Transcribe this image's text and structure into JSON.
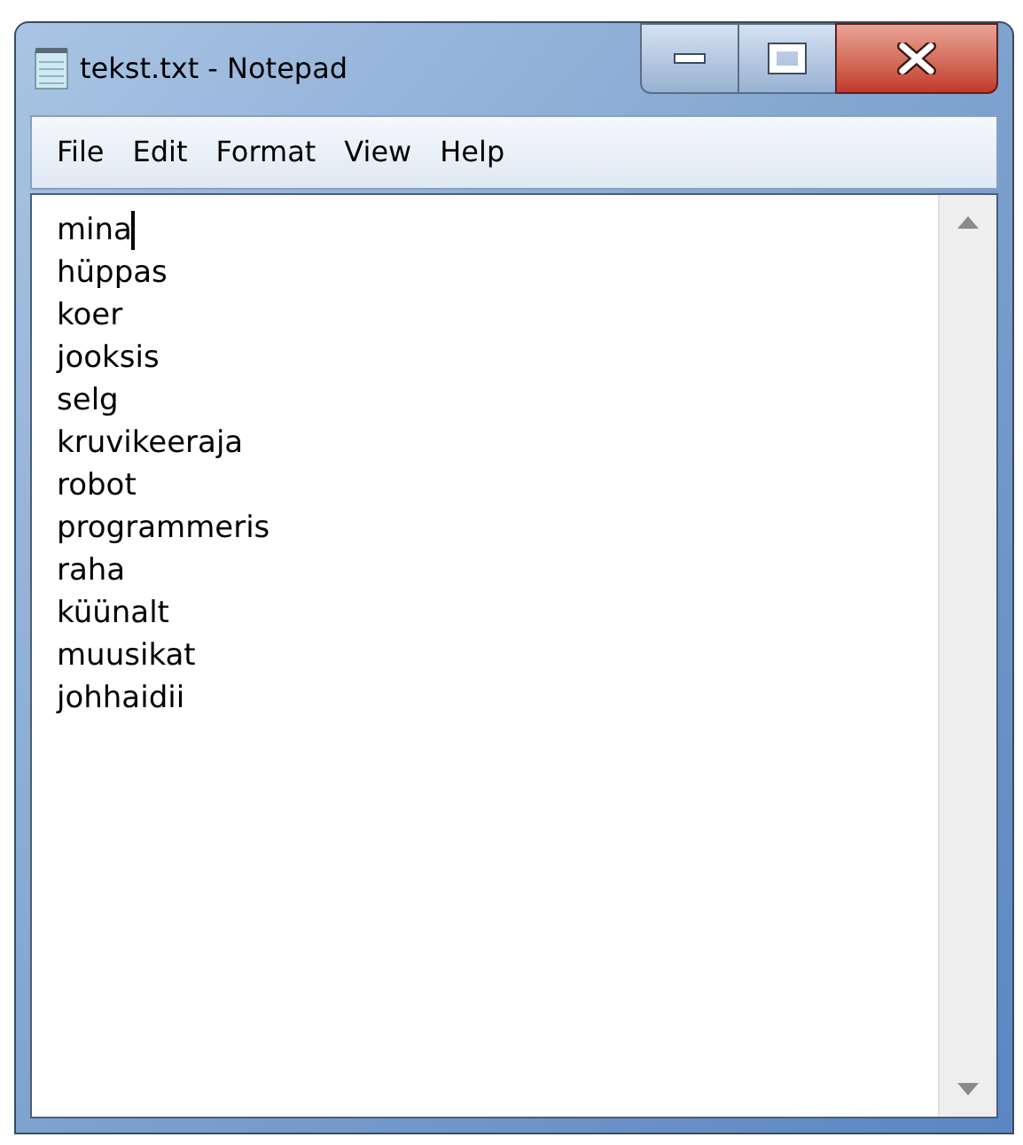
{
  "window": {
    "title": "tekst.txt - Notepad"
  },
  "menu": [
    "File",
    "Edit",
    "Format",
    "View",
    "Help"
  ],
  "editor": {
    "lines": [
      {
        "text": "mina",
        "cursor": true
      },
      {
        "text": "hüppas",
        "cursor": false
      },
      {
        "text": "koer",
        "cursor": false
      },
      {
        "text": "jooksis",
        "cursor": false
      },
      {
        "text": "selg",
        "cursor": false
      },
      {
        "text": "kruvikeeraja",
        "cursor": false
      },
      {
        "text": "robot",
        "cursor": false
      },
      {
        "text": "programmeris",
        "cursor": false
      },
      {
        "text": "raha",
        "cursor": false
      },
      {
        "text": "küünalt",
        "cursor": false
      },
      {
        "text": "muusikat",
        "cursor": false
      },
      {
        "text": "johhaidii",
        "cursor": false
      }
    ]
  }
}
